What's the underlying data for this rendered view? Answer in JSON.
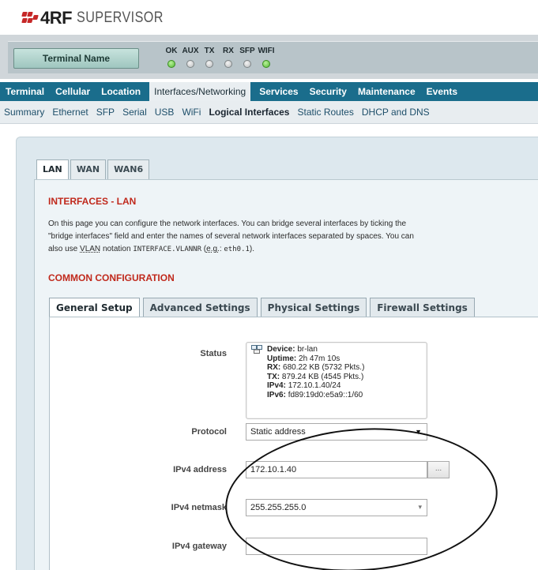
{
  "brand": {
    "name": "4RF",
    "product": "SUPERVISOR"
  },
  "status_bar": {
    "terminal_button": "Terminal Name",
    "leds": [
      {
        "label": "OK",
        "state": "on"
      },
      {
        "label": "AUX",
        "state": "off"
      },
      {
        "label": "TX",
        "state": "off"
      },
      {
        "label": "RX",
        "state": "off"
      },
      {
        "label": "SFP",
        "state": "off"
      },
      {
        "label": "WIFI",
        "state": "on"
      }
    ],
    "colors": {
      "led_on": "#55b735",
      "led_off": "#b9bcbd"
    }
  },
  "nav": {
    "main": [
      "Terminal",
      "Cellular",
      "Location",
      "Interfaces/Networking",
      "Services",
      "Security",
      "Maintenance",
      "Events"
    ],
    "active_main": "Interfaces/Networking",
    "sub": [
      "Summary",
      "Ethernet",
      "SFP",
      "Serial",
      "USB",
      "WiFi",
      "Logical Interfaces",
      "Static Routes",
      "DHCP and DNS"
    ],
    "active_sub": "Logical Interfaces",
    "colors": {
      "main_bg": "#1a6d8c"
    }
  },
  "lan_tabs": [
    "LAN",
    "WAN",
    "WAN6"
  ],
  "active_lan_tab": "LAN",
  "page": {
    "title": "INTERFACES - LAN",
    "desc_line1": "On this page you can configure the network interfaces. You can bridge several interfaces by ticking the",
    "desc_line2": "\"bridge interfaces\" field and enter the names of several network interfaces separated by spaces. You can",
    "desc_line3_pre": "also use",
    "desc_vlan": "VLAN",
    "desc_line3_mid": "notation",
    "desc_code1": "INTERFACE.VLANNR",
    "desc_eg_open": "(",
    "desc_eg": "e.g.",
    "desc_eg_colon": ":",
    "desc_code2": "eth0.1",
    "desc_eg_close": ").",
    "common_title": "COMMON CONFIGURATION",
    "accent_color": "#c0291c"
  },
  "settings_tabs": [
    "General Setup",
    "Advanced Settings",
    "Physical Settings",
    "Firewall Settings"
  ],
  "active_settings_tab": "General Setup",
  "form": {
    "status_label": "Status",
    "status": {
      "device_k": "Device:",
      "device_v": "br-lan",
      "uptime_k": "Uptime:",
      "uptime_v": "2h 47m 10s",
      "rx_k": "RX:",
      "rx_v": "680.22 KB (5732 Pkts.)",
      "tx_k": "TX:",
      "tx_v": "879.24 KB (4545 Pkts.)",
      "ipv4_k": "IPv4:",
      "ipv4_v": "172.10.1.40/24",
      "ipv6_k": "IPv6:",
      "ipv6_v": "fd89:19d0:e5a9::1/60"
    },
    "protocol_label": "Protocol",
    "protocol_value": "Static address",
    "ipv4_address_label": "IPv4 address",
    "ipv4_address_value": "172.10.1.40",
    "ipv4_address_button": "...",
    "ipv4_netmask_label": "IPv4 netmask",
    "ipv4_netmask_value": "255.255.255.0",
    "ipv4_gateway_label": "IPv4 gateway",
    "ipv4_gateway_value": ""
  }
}
